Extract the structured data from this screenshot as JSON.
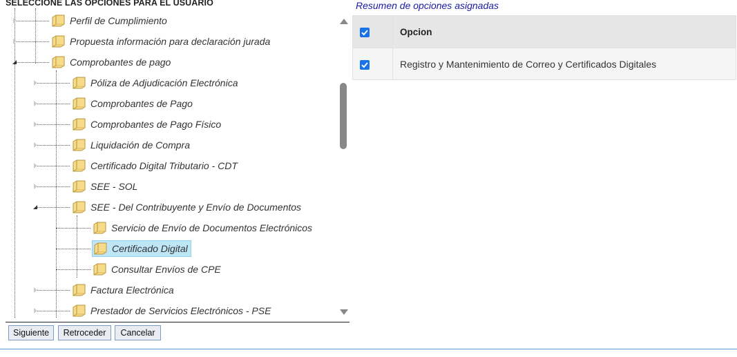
{
  "left_panel": {
    "title": "SELECCIONE LAS OPCIONES PARA EL USUARIO",
    "tree": [
      {
        "label": "Perfil de Cumplimiento",
        "level": 1,
        "expander": "collapsed",
        "selected": false
      },
      {
        "label": "Propuesta información para declaración jurada",
        "level": 1,
        "expander": "collapsed",
        "selected": false
      },
      {
        "label": "Comprobantes de pago",
        "level": 1,
        "expander": "expanded",
        "selected": false
      },
      {
        "label": "Póliza de Adjudicación Electrónica",
        "level": 2,
        "expander": "collapsed",
        "selected": false
      },
      {
        "label": "Comprobantes de Pago",
        "level": 2,
        "expander": "collapsed",
        "selected": false
      },
      {
        "label": "Comprobantes de Pago Físico",
        "level": 2,
        "expander": "collapsed",
        "selected": false
      },
      {
        "label": "Liquidación de Compra",
        "level": 2,
        "expander": "collapsed",
        "selected": false
      },
      {
        "label": "Certificado Digital Tributario - CDT",
        "level": 2,
        "expander": "collapsed",
        "selected": false
      },
      {
        "label": "SEE - SOL",
        "level": 2,
        "expander": "collapsed",
        "selected": false
      },
      {
        "label": "SEE - Del Contribuyente y Envío de Documentos",
        "level": 2,
        "expander": "expanded",
        "selected": false
      },
      {
        "label": "Servicio de Envío de Documentos Electrónicos",
        "level": 3,
        "expander": "none",
        "selected": false
      },
      {
        "label": "Certificado Digital",
        "level": 3,
        "expander": "none",
        "selected": true
      },
      {
        "label": "Consultar Envíos de CPE",
        "level": 3,
        "expander": "none",
        "selected": false
      },
      {
        "label": "Factura Electrónica",
        "level": 2,
        "expander": "collapsed",
        "selected": false
      },
      {
        "label": "Prestador de Servicios Electrónicos - PSE",
        "level": 2,
        "expander": "collapsed",
        "selected": false
      }
    ],
    "buttons": {
      "next": "Siguiente",
      "back": "Retroceder",
      "cancel": "Cancelar"
    }
  },
  "right_panel": {
    "title": "Resumen de opciones asignadas",
    "table": {
      "header": {
        "checked": true,
        "column": "Opcion"
      },
      "rows": [
        {
          "checked": true,
          "option": "Registro y Mantenimiento de Correo y Certificados Digitales"
        }
      ]
    }
  },
  "colors": {
    "checkbox": "#1a73e8",
    "selected_bg": "#bfe6f7",
    "title_link": "#1a1aa6",
    "bottom_rule": "#5b9bd5"
  }
}
